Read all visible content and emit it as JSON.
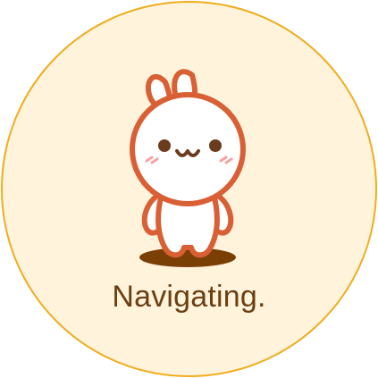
{
  "status": {
    "label": "Navigating."
  },
  "theme": {
    "circle_fill": "#fff3dc",
    "circle_border": "#f0ad1e",
    "outline": "#d95f35",
    "text": "#6b3f11",
    "shadow": "#7a3f05",
    "cheek": "#f7a2a2"
  },
  "icons": {
    "mascot": "bunny-mascot-icon"
  }
}
